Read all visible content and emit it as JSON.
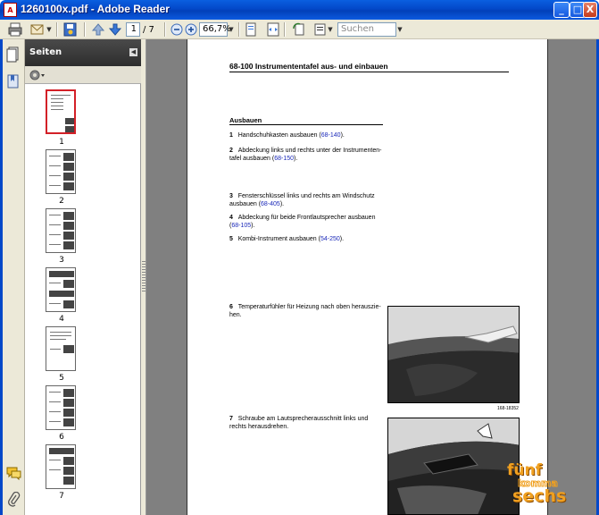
{
  "window": {
    "title": "1260100x.pdf - Adobe Reader",
    "minimize": "_",
    "maximize": "□",
    "close": "X"
  },
  "toolbar": {
    "page_value": "1",
    "page_total": "/ 7",
    "zoom_value": "66,7%",
    "search_placeholder": "Suchen"
  },
  "panel": {
    "title": "Seiten",
    "pages": [
      "1",
      "2",
      "3",
      "4",
      "5",
      "6",
      "7"
    ]
  },
  "document": {
    "heading": "68-100 Instrumententafel aus- und einbauen",
    "section": "Ausbauen",
    "steps": [
      {
        "num": "1",
        "text": "Handschuhkasten ausbauen (",
        "link": "68-140",
        "end": ")."
      },
      {
        "num": "2",
        "text": "Abdeckung links und rechts unter der Instrumenten-",
        "text2": "tafel ausbauen (",
        "link": "68-150",
        "end": ")."
      },
      {
        "num": "3",
        "text": "Fensterschlüssel links und rechts am Windschutz",
        "text2": "ausbauen (",
        "link": "68-405",
        "end": ")."
      },
      {
        "num": "4",
        "text": "Abdeckung für beide Frontlautsprecher ausbauen",
        "text2": "(",
        "link": "68-105",
        "end": ")."
      },
      {
        "num": "5",
        "text": "Kombi-Instrument ausbauen (",
        "link": "54-250",
        "end": ")."
      },
      {
        "num": "6",
        "text": "Temperaturfühler für Heizung nach oben herauszie-",
        "text2": "hen."
      },
      {
        "num": "7",
        "text": "Schraube am Lautsprecherausschnitt links und",
        "text2": "rechts herausdrehen."
      }
    ],
    "photo_caption_1": "168-18352"
  },
  "watermark": {
    "line1": "fünf",
    "line2": "komma",
    "line3": "sechs"
  }
}
